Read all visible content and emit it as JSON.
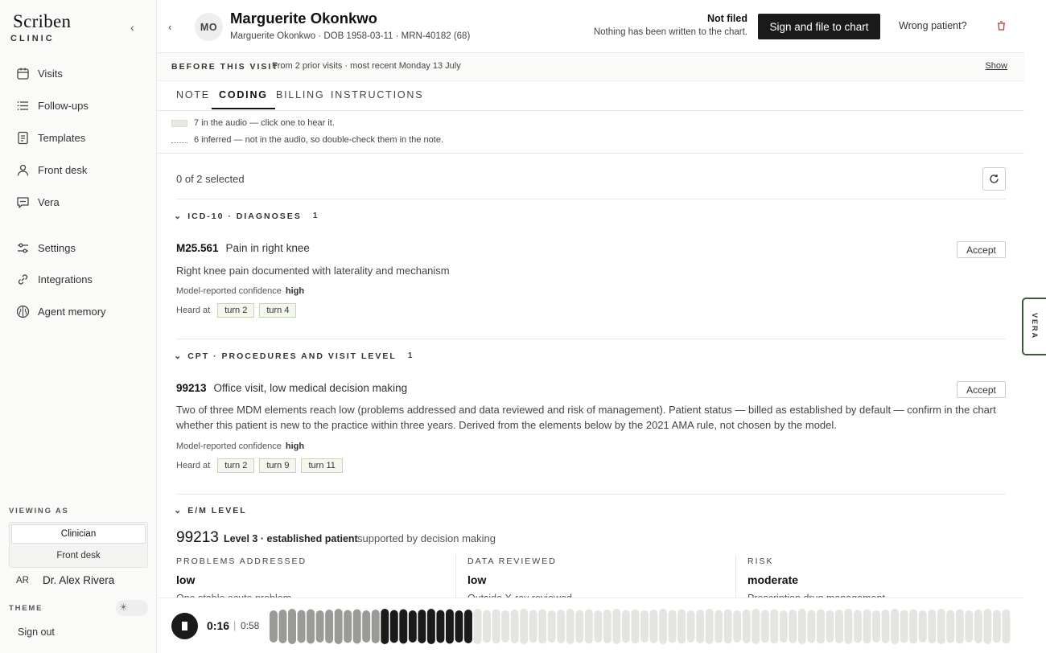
{
  "sidebar": {
    "logo": "Scriben",
    "logo_sub": "CLINIC",
    "collapse_icon": "chevron-left-icon",
    "nav": [
      {
        "label": "Visits",
        "icon": "calendar-icon"
      },
      {
        "label": "Follow-ups",
        "icon": "list-icon"
      },
      {
        "label": "Templates",
        "icon": "document-icon"
      },
      {
        "label": "Front desk",
        "icon": "person-icon"
      },
      {
        "label": "Vera",
        "icon": "chat-icon"
      },
      {
        "label": "Settings",
        "icon": "sliders-icon"
      },
      {
        "label": "Integrations",
        "icon": "link-icon"
      },
      {
        "label": "Agent memory",
        "icon": "brain-icon"
      }
    ],
    "viewing_as_label": "VIEWING AS",
    "roles": [
      "Clinician",
      "Front desk"
    ],
    "active_role": "Clinician",
    "user_initials": "AR",
    "user_name": "Dr. Alex Rivera",
    "theme_label": "THEME",
    "sign_out": "Sign out"
  },
  "header": {
    "avatar_initials": "MO",
    "patient_name": "Marguerite Okonkwo",
    "patient_meta": "Marguerite Okonkwo · DOB 1958-03-11 · MRN-40182 (68)",
    "status_title": "Not filed",
    "status_sub": "Nothing has been written to the chart.",
    "sign_button": "Sign and file to chart",
    "wrong_patient": "Wrong patient?"
  },
  "before_visit": {
    "label": "BEFORE THIS VISIT",
    "text": "From 2 prior visits · most recent Monday 13 July",
    "show": "Show"
  },
  "tabs": [
    "NOTE",
    "CODING",
    "BILLING",
    "INSTRUCTIONS"
  ],
  "active_tab": "CODING",
  "legend": {
    "heard": "7 in the audio — click one to hear it.",
    "inferred": "6 inferred — not in the audio, so double-check them in the note."
  },
  "selection": "0 of 2 selected",
  "icd": {
    "header": "ICD-10 · DIAGNOSES",
    "count": "1",
    "code": "M25.561",
    "desc": "Pain in right knee",
    "accept": "Accept",
    "rationale": "Right knee pain documented with laterality and mechanism",
    "conf_label": "Model-reported confidence",
    "conf_value": "high",
    "heard_label": "Heard at",
    "turns": [
      "turn 2",
      "turn 4"
    ]
  },
  "cpt": {
    "header": "CPT · PROCEDURES AND VISIT LEVEL",
    "count": "1",
    "code": "99213",
    "desc": "Office visit, low medical decision making",
    "accept": "Accept",
    "rationale": "Two of three MDM elements reach low (problems addressed and data reviewed and risk of management). Patient status — billed as established by default — confirm in the chart whether this patient is new to the practice within three years. Derived from the elements below by the 2021 AMA rule, not chosen by the model.",
    "conf_label": "Model-reported confidence",
    "conf_value": "high",
    "heard_label": "Heard at",
    "turns": [
      "turn 2",
      "turn 9",
      "turn 11"
    ]
  },
  "em": {
    "header": "E/M LEVEL",
    "code": "99213",
    "level": "Level 3 · established patient",
    "supported": "supported by decision making",
    "columns": [
      {
        "heading": "PROBLEMS ADDRESSED",
        "value": "low",
        "detail": "One stable acute problem"
      },
      {
        "heading": "DATA REVIEWED",
        "value": "low",
        "detail": "Outside X-ray reviewed"
      },
      {
        "heading": "RISK",
        "value": "moderate",
        "detail": "Prescription drug management"
      }
    ]
  },
  "vera_tab": "VERA",
  "player": {
    "current": "0:16",
    "duration": "0:58",
    "progress": 0.28
  }
}
